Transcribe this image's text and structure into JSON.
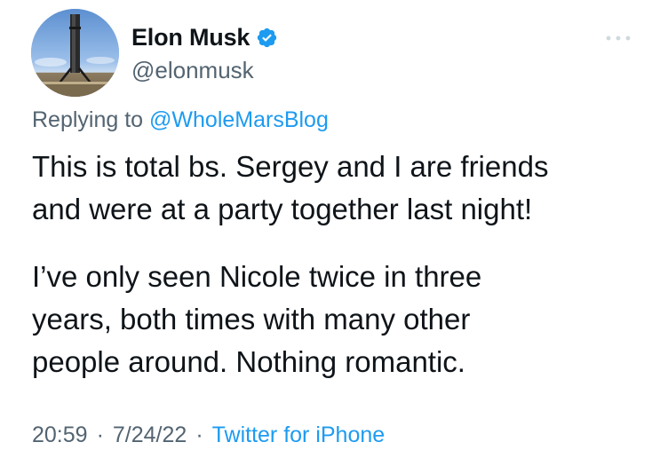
{
  "author": {
    "display_name": "Elon Musk",
    "handle": "@elonmusk",
    "verified": true
  },
  "replying_to": {
    "prefix": "Replying to",
    "handle": "@WholeMarsBlog"
  },
  "body": {
    "paragraph1": [
      "This is total bs. Sergey and I are friends",
      "and were at a party together last night!"
    ],
    "paragraph2": [
      "I’ve only seen Nicole twice in three",
      "years, both times with many other",
      "people around. Nothing romantic."
    ]
  },
  "meta": {
    "time": "20:59",
    "date": "7/24/22",
    "source": "Twitter for iPhone",
    "separator": "·"
  },
  "icons": {
    "avatar": "rocket-avatar",
    "verified": "verified-badge-icon",
    "more": "more-options-icon"
  },
  "colors": {
    "accent": "#1d9bf0",
    "secondary_text": "#536471",
    "primary_text": "#0f1419"
  }
}
